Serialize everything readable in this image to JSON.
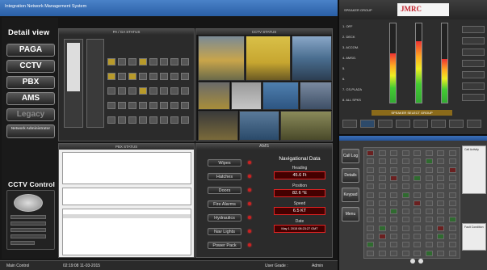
{
  "main": {
    "title": "Integration Network Management System",
    "detail_view": "Detail view",
    "systems": [
      "PAGA",
      "CCTV",
      "PBX",
      "AMS",
      "Legacy",
      "Network Administrator"
    ],
    "cctv_control": "CCTV Control",
    "panels": {
      "pa_ga_status": "PA / GA STATUS",
      "cctv_status": "CCTV STATUS",
      "pbx_status": "PBX STATUS",
      "ams": "AMS"
    },
    "ams_buttons": [
      "Wipes",
      "Hatches",
      "Doors",
      "Fire Alarms",
      "Hydraulics",
      "Nav Lights",
      "Power Pack"
    ],
    "nav_data": {
      "title": "Navigational Data",
      "labels": [
        "Heading",
        "Position",
        "Speed",
        "Date"
      ],
      "values": [
        "45.6 Ft",
        "82.6 °E",
        "6.5 KT",
        "May 1 2015 08:23:27 GMT"
      ]
    },
    "status_bar": {
      "label": "Main Control",
      "time": "02:19:08  11-03-2015",
      "user_grade": "User Grade :",
      "user": "Admin"
    }
  },
  "speaker": {
    "title": "SPEAKER GROUP",
    "brand": "JMRC",
    "items": [
      "1. OFF",
      "2. DECK",
      "3. ACCOM.",
      "4. AMSG.",
      "5.",
      "6.",
      "7. CS-PLAZA",
      "8. ALL SPKS"
    ],
    "select_group": "SPEAKER SELECT GROUP",
    "meter_levels": [
      0.62,
      0.78,
      0.55
    ],
    "colors": {
      "accent_red": "#c0202a"
    }
  },
  "access": {
    "side_buttons": [
      "Call Log",
      "Details",
      "Keypad",
      "Menu"
    ],
    "call_activity": "Call Activity",
    "fault_condition": "Fault Condition"
  }
}
